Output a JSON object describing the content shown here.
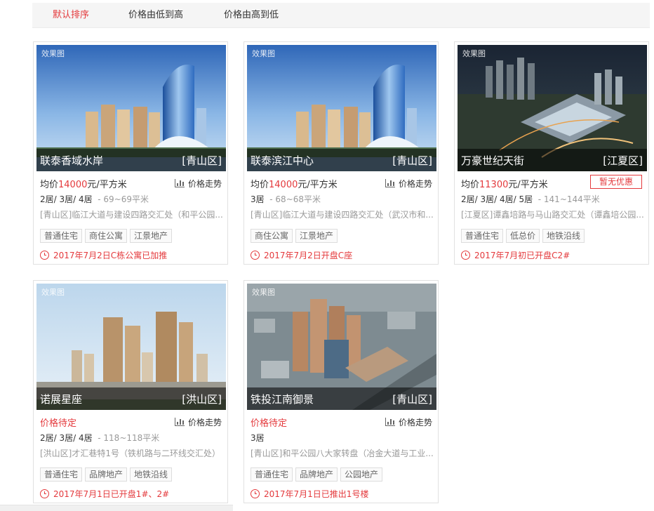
{
  "sort": {
    "items": [
      "默认排序",
      "价格由低到高",
      "价格由高到低"
    ],
    "active_index": 0
  },
  "effect_label": "效果图",
  "trend_label": "价格走势",
  "colors": {
    "accent": "#e4393c",
    "muted": "#999999"
  },
  "listings": [
    {
      "name": "联泰香域水岸",
      "district": "[青山区]",
      "price": {
        "prefix": "均价",
        "value": "14000",
        "unit": "元/平方米"
      },
      "rooms": "2居/ 3居/ 4居",
      "area": "- 69~69平米",
      "address": "[青山区]临江大道与建设四路交汇处（和平公园...",
      "tags": [
        "普通住宅",
        "商住公寓",
        "江景地产"
      ],
      "status": "2017年7月2日C栋公寓已加推"
    },
    {
      "name": "联泰滨江中心",
      "district": "[青山区]",
      "price": {
        "prefix": "均价",
        "value": "14000",
        "unit": "元/平方米"
      },
      "rooms": "3居",
      "area": "- 68~68平米",
      "address": "[青山区]临江大道与建设四路交汇处（武汉市和...",
      "tags": [
        "商住公寓",
        "江景地产"
      ],
      "status": "2017年7月2日开盘C座"
    },
    {
      "name": "万豪世纪天街",
      "district": "[江夏区]",
      "price": {
        "prefix": "均价",
        "value": "11300",
        "unit": "元/平方米"
      },
      "promo": "暂无优惠",
      "rooms": "2居/ 3居/ 4居/ 5居",
      "area": "- 141~144平米",
      "address": "[江夏区]谭鑫培路与马山路交汇处（谭鑫培公园...",
      "tags": [
        "普通住宅",
        "低总价",
        "地铁沿线"
      ],
      "status": "2017年7月初已开盘C2#"
    },
    {
      "name": "诺展星座",
      "district": "[洪山区]",
      "price_pending": "价格待定",
      "rooms": "2居/ 3居/ 4居",
      "area": "- 118~118平米",
      "address": "[洪山区]才汇巷特1号（铁机路与二环线交汇处）",
      "tags": [
        "普通住宅",
        "品牌地产",
        "地铁沿线"
      ],
      "status": "2017年7月1日已开盘1#、2#"
    },
    {
      "name": "铁投江南御景",
      "district": "[青山区]",
      "price_pending": "价格待定",
      "rooms": "3居",
      "area": "",
      "address": "[青山区]和平公园八大家转盘（冶金大道与工业...",
      "tags": [
        "普通住宅",
        "品牌地产",
        "公园地产"
      ],
      "status": "2017年7月1日已推出1号楼"
    }
  ]
}
